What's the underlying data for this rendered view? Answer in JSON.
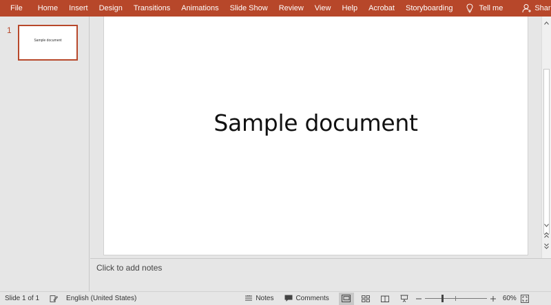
{
  "ribbon": {
    "tabs": [
      "File",
      "Home",
      "Insert",
      "Design",
      "Transitions",
      "Animations",
      "Slide Show",
      "Review",
      "View",
      "Help",
      "Acrobat",
      "Storyboarding"
    ],
    "tell_me": "Tell me",
    "share": "Share",
    "color": "#b7472a"
  },
  "thumbnails": [
    {
      "number": "1",
      "text": "Sample document"
    }
  ],
  "slide": {
    "title": "Sample document"
  },
  "notes": {
    "placeholder": "Click to add notes"
  },
  "status": {
    "slide_info": "Slide 1 of 1",
    "language": "English (United States)",
    "notes_label": "Notes",
    "comments_label": "Comments",
    "zoom": "60%",
    "zoom_level": 0.6
  }
}
